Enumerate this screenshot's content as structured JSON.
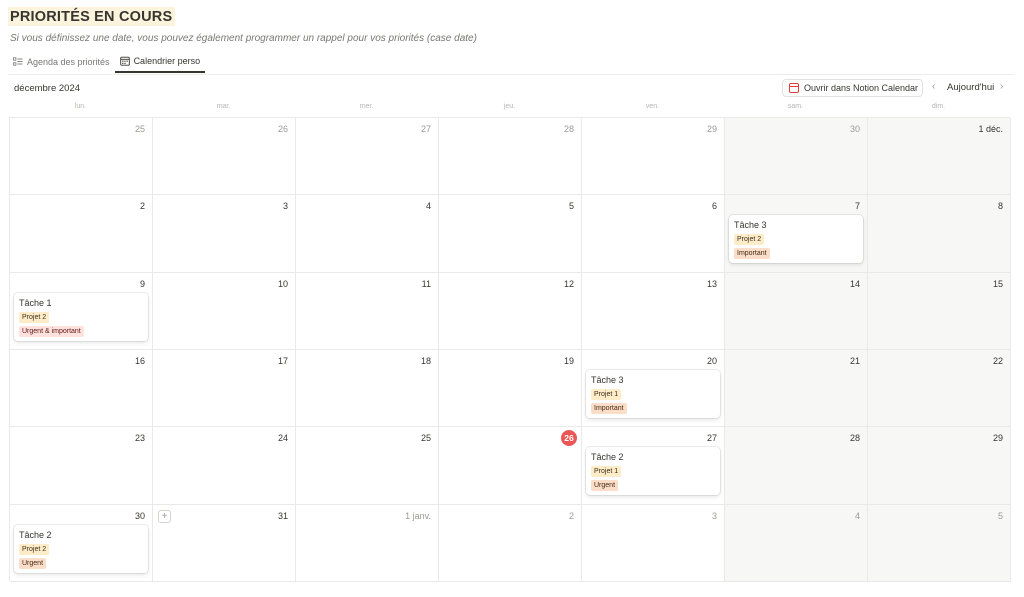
{
  "header": {
    "title": "PRIORITÉS EN COURS",
    "subtitle": "Si vous définissez une date, vous pouvez également programmer un rappel pour vos priorités (case date)"
  },
  "tabs": [
    {
      "label": "Agenda des priorités",
      "icon": "checklist-icon",
      "active": false
    },
    {
      "label": "Calendrier perso",
      "icon": "calendar-icon",
      "active": true
    }
  ],
  "toolbar": {
    "month_label": "décembre 2024",
    "open_calendar_label": "Ouvrir dans Notion Calendar",
    "prev_icon": "chevron-left-icon",
    "next_icon": "chevron-right-icon",
    "today_label": "Aujourd'hui"
  },
  "weekdays": [
    "lun.",
    "mar.",
    "mer.",
    "jeu.",
    "ven.",
    "sam.",
    "dim."
  ],
  "colors": {
    "today": "#eb5757",
    "project_tag": "#fdecc8",
    "important_tag": "#fadec9",
    "urgent_important_tag": "#ffe2dd",
    "title_highlight": "#fbf3db",
    "weekend": "#f7f7f5"
  },
  "weeks": [
    [
      {
        "label": "25",
        "other": true
      },
      {
        "label": "26",
        "other": true
      },
      {
        "label": "27",
        "other": true
      },
      {
        "label": "28",
        "other": true
      },
      {
        "label": "29",
        "other": true
      },
      {
        "label": "30",
        "other": true
      },
      {
        "label": "1 déc."
      }
    ],
    [
      {
        "label": "2"
      },
      {
        "label": "3"
      },
      {
        "label": "4"
      },
      {
        "label": "5"
      },
      {
        "label": "6"
      },
      {
        "label": "7",
        "event": {
          "title": "Tâche 3",
          "project": "Projet 2",
          "priority": "Important",
          "priority_color": "orange"
        }
      },
      {
        "label": "8"
      }
    ],
    [
      {
        "label": "9",
        "event": {
          "title": "Tâche 1",
          "project": "Projet 2",
          "priority": "Urgent & important",
          "priority_color": "red"
        }
      },
      {
        "label": "10"
      },
      {
        "label": "11"
      },
      {
        "label": "12"
      },
      {
        "label": "13"
      },
      {
        "label": "14"
      },
      {
        "label": "15"
      }
    ],
    [
      {
        "label": "16"
      },
      {
        "label": "17"
      },
      {
        "label": "18"
      },
      {
        "label": "19"
      },
      {
        "label": "20",
        "event": {
          "title": "Tâche 3",
          "project": "Projet 1",
          "priority": "Important",
          "priority_color": "orange"
        }
      },
      {
        "label": "21"
      },
      {
        "label": "22"
      }
    ],
    [
      {
        "label": "23"
      },
      {
        "label": "24"
      },
      {
        "label": "25"
      },
      {
        "label": "26",
        "today": true
      },
      {
        "label": "27",
        "event": {
          "title": "Tâche 2",
          "project": "Projet 1",
          "priority": "Urgent",
          "priority_color": "orange"
        }
      },
      {
        "label": "28"
      },
      {
        "label": "29"
      }
    ],
    [
      {
        "label": "30",
        "event": {
          "title": "Tâche 2",
          "project": "Projet 2",
          "priority": "Urgent",
          "priority_color": "orange"
        }
      },
      {
        "label": "31",
        "add_button": true
      },
      {
        "label": "1 janv.",
        "other": true
      },
      {
        "label": "2",
        "other": true
      },
      {
        "label": "3",
        "other": true
      },
      {
        "label": "4",
        "other": true
      },
      {
        "label": "5",
        "other": true
      }
    ]
  ]
}
